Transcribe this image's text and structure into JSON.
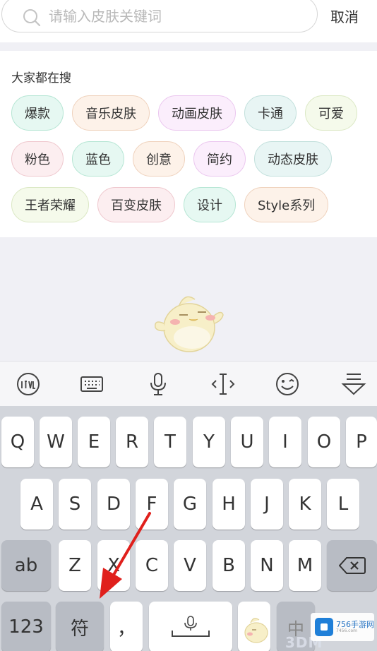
{
  "search": {
    "placeholder": "请输入皮肤关键词",
    "value": "",
    "cancel_label": "取消"
  },
  "hot": {
    "title": "大家都在搜",
    "rows": [
      [
        {
          "label": "爆款",
          "bg": "#e6f8f2",
          "border": "#b6e6d4"
        },
        {
          "label": "音乐皮肤",
          "bg": "#fdf2e9",
          "border": "#efd2bd"
        },
        {
          "label": "动画皮肤",
          "bg": "#fbeefc",
          "border": "#ebc7ef"
        },
        {
          "label": "卡通",
          "bg": "#e8f5f4",
          "border": "#c2e0dc"
        },
        {
          "label": "可爱",
          "bg": "#f5faeb",
          "border": "#dbe8c4"
        }
      ],
      [
        {
          "label": "粉色",
          "bg": "#fceef0",
          "border": "#efc8ce"
        },
        {
          "label": "蓝色",
          "bg": "#e6f8f2",
          "border": "#b6e6d4"
        },
        {
          "label": "创意",
          "bg": "#fdf2e9",
          "border": "#efd2bd"
        },
        {
          "label": "简约",
          "bg": "#fbeefc",
          "border": "#ebc7ef"
        },
        {
          "label": "动态皮肤",
          "bg": "#e8f5f4",
          "border": "#c2e0dc"
        }
      ],
      [
        {
          "label": "王者荣耀",
          "bg": "#f5faeb",
          "border": "#dbe8c4"
        },
        {
          "label": "百变皮肤",
          "bg": "#fceef0",
          "border": "#efc8ce"
        },
        {
          "label": "设计",
          "bg": "#e6f8f2",
          "border": "#b6e6d4"
        },
        {
          "label": "Style系列",
          "bg": "#fdf2e9",
          "border": "#efd2bd"
        }
      ]
    ]
  },
  "toolbar": {
    "icons": [
      "iflytek-logo-icon",
      "keyboard-icon",
      "microphone-icon",
      "cursor-move-icon",
      "emoji-icon",
      "hide-keyboard-icon"
    ]
  },
  "keyboard": {
    "row1": [
      "Q",
      "W",
      "E",
      "R",
      "T",
      "Y",
      "U",
      "I",
      "O",
      "P"
    ],
    "row2": [
      "A",
      "S",
      "D",
      "F",
      "G",
      "H",
      "J",
      "K",
      "L"
    ],
    "row3": [
      "Z",
      "X",
      "C",
      "V",
      "B",
      "N",
      "M"
    ],
    "shift_label": "ab",
    "numbers_label": "123",
    "symbols_label": "符",
    "comma_label": "，",
    "lang_label": "中"
  },
  "watermark": {
    "brand": "756手游网",
    "domain": "7456.com",
    "overlay": "3DM"
  },
  "colors": {
    "annotation_arrow": "#e0201c",
    "keyboard_bg": "#d2d5db",
    "func_key": "#b8bcc4"
  }
}
